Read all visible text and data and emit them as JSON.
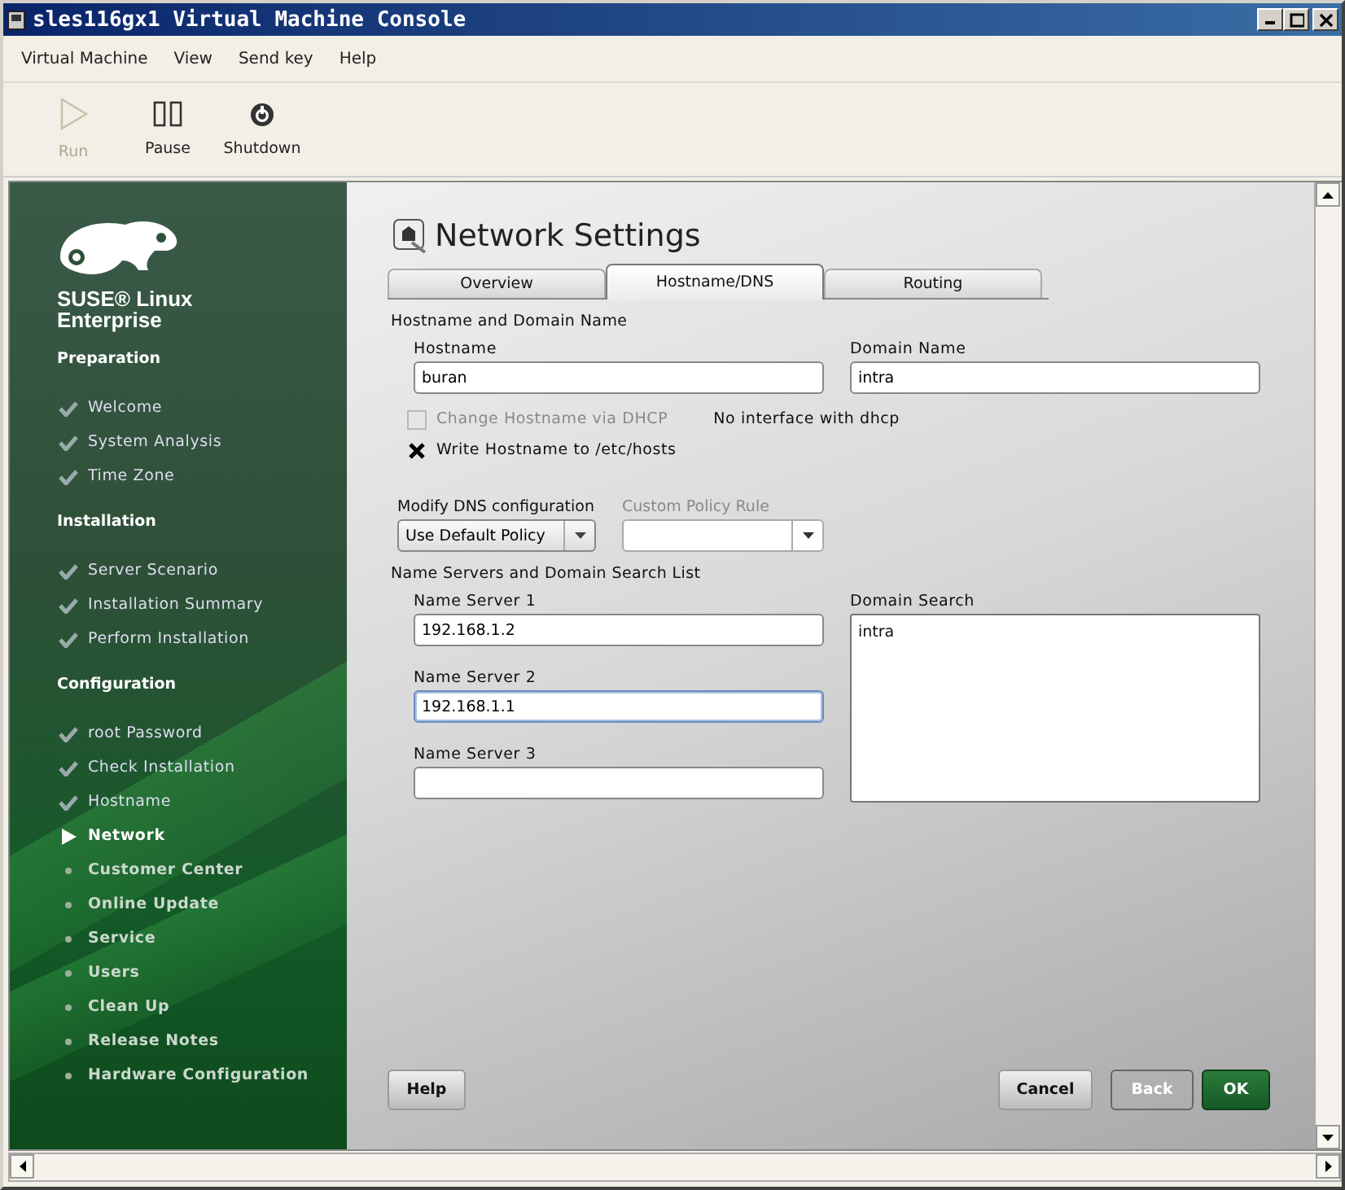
{
  "window": {
    "title": "sles116gx1 Virtual Machine Console"
  },
  "menu": [
    {
      "label": "Virtual Machine"
    },
    {
      "label": "View"
    },
    {
      "label": "Send key"
    },
    {
      "label": "Help"
    }
  ],
  "toolbar": [
    {
      "kind": "run",
      "label": "Run",
      "disabled": true
    },
    {
      "kind": "pause",
      "label": "Pause",
      "disabled": false
    },
    {
      "kind": "shutdown",
      "label": "Shutdown",
      "disabled": false
    }
  ],
  "sidebar": {
    "brand": "SUSE® Linux Enterprise",
    "sections": [
      {
        "title": "Preparation",
        "steps": [
          {
            "label": "Welcome",
            "done": true,
            "current": false
          },
          {
            "label": "System Analysis",
            "done": true,
            "current": false
          },
          {
            "label": "Time Zone",
            "done": true,
            "current": false
          }
        ]
      },
      {
        "title": "Installation",
        "steps": [
          {
            "label": "Server Scenario",
            "done": true,
            "current": false
          },
          {
            "label": "Installation Summary",
            "done": true,
            "current": false
          },
          {
            "label": "Perform Installation",
            "done": true,
            "current": false
          }
        ]
      },
      {
        "title": "Configuration",
        "steps": [
          {
            "label": "root Password",
            "done": true,
            "current": false
          },
          {
            "label": "Check Installation",
            "done": true,
            "current": false
          },
          {
            "label": "Hostname",
            "done": true,
            "current": false
          },
          {
            "label": "Network",
            "done": false,
            "current": true
          },
          {
            "label": "Customer Center",
            "done": false,
            "current": false
          },
          {
            "label": "Online Update",
            "done": false,
            "current": false
          },
          {
            "label": "Service",
            "done": false,
            "current": false
          },
          {
            "label": "Users",
            "done": false,
            "current": false
          },
          {
            "label": "Clean Up",
            "done": false,
            "current": false
          },
          {
            "label": "Release Notes",
            "done": false,
            "current": false
          },
          {
            "label": "Hardware Configuration",
            "done": false,
            "current": false
          }
        ]
      }
    ]
  },
  "page": {
    "title": "Network Settings",
    "tabs": [
      {
        "label": "Overview",
        "selected": false
      },
      {
        "label": "Hostname/DNS",
        "selected": true
      },
      {
        "label": "Routing",
        "selected": false
      }
    ],
    "hostname_group": {
      "title": "Hostname and Domain Name",
      "hostname": {
        "label": "Hostname",
        "value": "buran"
      },
      "domain": {
        "label": "Domain Name",
        "value": "intra"
      },
      "checkboxes": [
        {
          "label": "Change Hostname via DHCP",
          "checked": false,
          "disabled": true,
          "note": "No interface with dhcp"
        },
        {
          "label": "Write Hostname to /etc/hosts",
          "checked": true,
          "disabled": false
        }
      ]
    },
    "dns_mode": {
      "label": "Modify DNS configuration",
      "value": "Use Default Policy",
      "disabled": false
    },
    "custom_policy": {
      "label": "Custom Policy Rule",
      "disabled": true
    },
    "servers_group": {
      "title": "Name Servers and Domain Search List",
      "name_servers": [
        {
          "label": "Name Server 1",
          "value": "192.168.1.2",
          "focused": false
        },
        {
          "label": "Name Server 2",
          "value": "192.168.1.1",
          "focused": true
        },
        {
          "label": "Name Server 3",
          "focused": false
        }
      ],
      "domain_search": {
        "label": "Domain Search",
        "value": "intra"
      }
    },
    "buttons": [
      {
        "kind": "help",
        "label": "Help"
      },
      {
        "kind": "cancel",
        "label": "Cancel"
      },
      {
        "kind": "back",
        "label": "Back"
      },
      {
        "kind": "ok",
        "label": "OK"
      }
    ]
  }
}
